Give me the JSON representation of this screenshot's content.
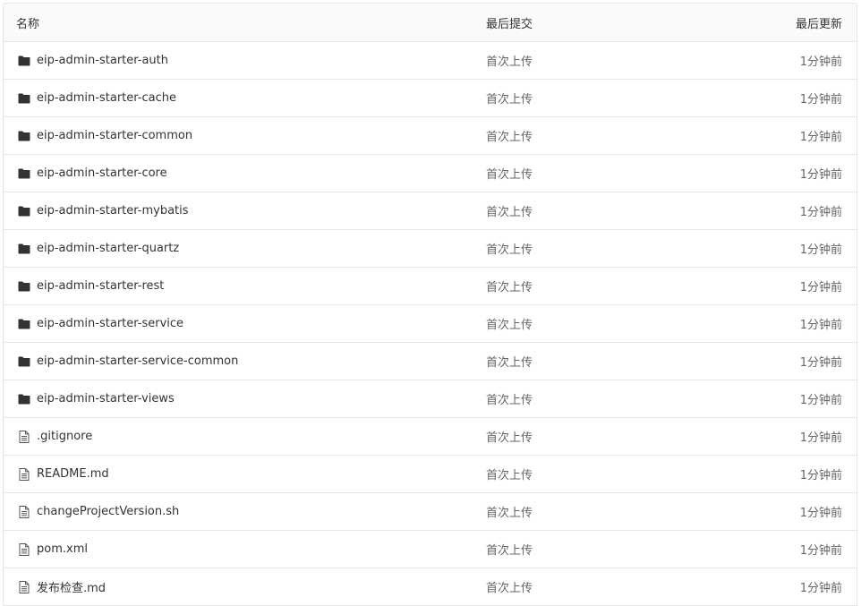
{
  "table": {
    "headers": {
      "name": "名称",
      "last_commit": "最后提交",
      "last_updated": "最后更新"
    },
    "rows": [
      {
        "type": "folder",
        "icon": "folder-icon",
        "name": "eip-admin-starter-auth",
        "commit": "首次上传",
        "updated": "1分钟前"
      },
      {
        "type": "folder",
        "icon": "folder-icon",
        "name": "eip-admin-starter-cache",
        "commit": "首次上传",
        "updated": "1分钟前"
      },
      {
        "type": "folder",
        "icon": "folder-icon",
        "name": "eip-admin-starter-common",
        "commit": "首次上传",
        "updated": "1分钟前"
      },
      {
        "type": "folder",
        "icon": "folder-icon",
        "name": "eip-admin-starter-core",
        "commit": "首次上传",
        "updated": "1分钟前"
      },
      {
        "type": "folder",
        "icon": "folder-icon",
        "name": "eip-admin-starter-mybatis",
        "commit": "首次上传",
        "updated": "1分钟前"
      },
      {
        "type": "folder",
        "icon": "folder-icon",
        "name": "eip-admin-starter-quartz",
        "commit": "首次上传",
        "updated": "1分钟前"
      },
      {
        "type": "folder",
        "icon": "folder-icon",
        "name": "eip-admin-starter-rest",
        "commit": "首次上传",
        "updated": "1分钟前"
      },
      {
        "type": "folder",
        "icon": "folder-icon",
        "name": "eip-admin-starter-service",
        "commit": "首次上传",
        "updated": "1分钟前"
      },
      {
        "type": "folder",
        "icon": "folder-icon",
        "name": "eip-admin-starter-service-common",
        "commit": "首次上传",
        "updated": "1分钟前"
      },
      {
        "type": "folder",
        "icon": "folder-icon",
        "name": "eip-admin-starter-views",
        "commit": "首次上传",
        "updated": "1分钟前"
      },
      {
        "type": "file",
        "icon": "file-icon",
        "name": ".gitignore",
        "commit": "首次上传",
        "updated": "1分钟前"
      },
      {
        "type": "file",
        "icon": "file-icon",
        "name": "README.md",
        "commit": "首次上传",
        "updated": "1分钟前"
      },
      {
        "type": "file",
        "icon": "file-icon",
        "name": "changeProjectVersion.sh",
        "commit": "首次上传",
        "updated": "1分钟前"
      },
      {
        "type": "file",
        "icon": "file-icon",
        "name": "pom.xml",
        "commit": "首次上传",
        "updated": "1分钟前"
      },
      {
        "type": "file",
        "icon": "file-icon",
        "name": "发布检查.md",
        "commit": "首次上传",
        "updated": "1分钟前"
      }
    ]
  },
  "colors": {
    "border": "#e5e5e5",
    "header_bg": "#fafafa",
    "text": "#333333",
    "muted": "#666666"
  }
}
